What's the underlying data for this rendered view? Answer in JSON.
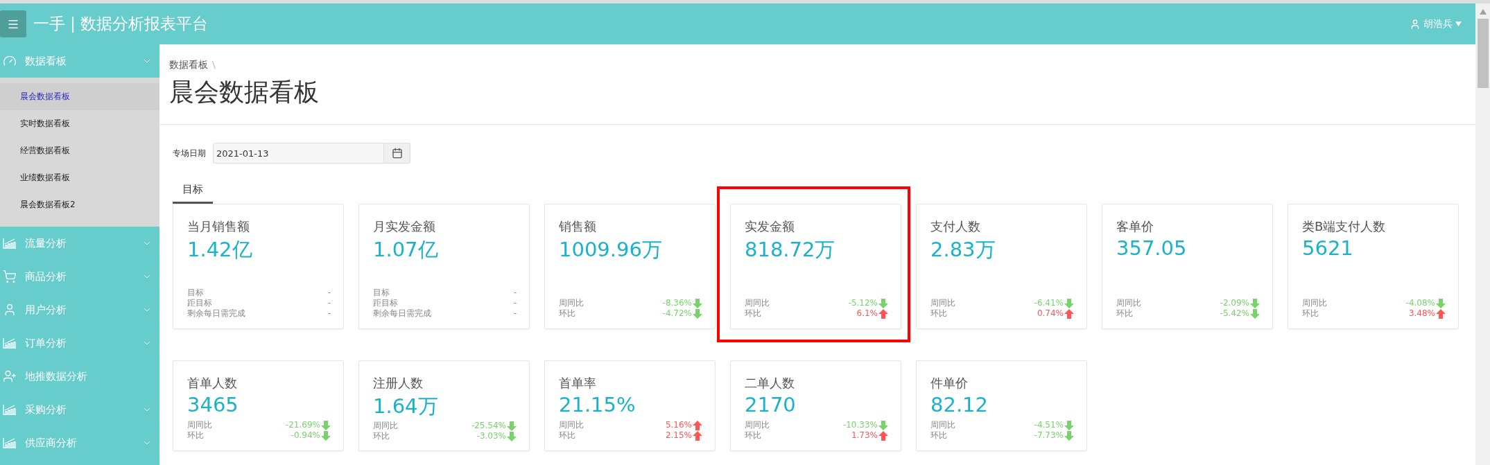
{
  "header": {
    "title": "一手 | 数据分析报表平台",
    "user": "胡浩兵"
  },
  "sidebar": {
    "items": [
      {
        "label": "数据看板",
        "kind": "gauge",
        "expandable": true,
        "expanded": true,
        "children": [
          {
            "label": "晨会数据看板",
            "selected": true
          },
          {
            "label": "实时数据看板",
            "selected": false
          },
          {
            "label": "经营数据看板",
            "selected": false
          },
          {
            "label": "业绩数据看板",
            "selected": false
          },
          {
            "label": "晨会数据看板2",
            "selected": false
          }
        ]
      },
      {
        "label": "流量分析",
        "kind": "chart",
        "expandable": true,
        "expanded": false
      },
      {
        "label": "商品分析",
        "kind": "cart",
        "expandable": true,
        "expanded": false
      },
      {
        "label": "用户分析",
        "kind": "user",
        "expandable": true,
        "expanded": false
      },
      {
        "label": "订单分析",
        "kind": "chart",
        "expandable": true,
        "expanded": false
      },
      {
        "label": "地推数据分析",
        "kind": "user-add",
        "expandable": false
      },
      {
        "label": "采购分析",
        "kind": "chart",
        "expandable": true,
        "expanded": false
      },
      {
        "label": "供应商分析",
        "kind": "chart",
        "expandable": true,
        "expanded": false
      }
    ]
  },
  "breadcrumb": [
    "数据看板"
  ],
  "breadcrumb_separator": "\\",
  "page_title": "晨会数据看板",
  "filter": {
    "label": "专场日期",
    "value": "2021-01-13"
  },
  "tabs": [
    {
      "label": "目标",
      "selected": true
    }
  ],
  "cards": [
    {
      "title": "当月销售额",
      "value": "1.42亿",
      "highlighted": false,
      "metrics": [
        {
          "label": "目标",
          "value": "-",
          "kind": "plain"
        },
        {
          "label": "距目标",
          "value": "-",
          "kind": "plain"
        },
        {
          "label": "剩余每日需完成",
          "value": "-",
          "kind": "plain"
        }
      ]
    },
    {
      "title": "月实发金额",
      "value": "1.07亿",
      "highlighted": false,
      "metrics": [
        {
          "label": "目标",
          "value": "-",
          "kind": "plain"
        },
        {
          "label": "距目标",
          "value": "-",
          "kind": "plain"
        },
        {
          "label": "剩余每日需完成",
          "value": "-",
          "kind": "plain"
        }
      ]
    },
    {
      "title": "销售额",
      "value": "1009.96万",
      "highlighted": false,
      "metrics": [
        {
          "label": "周同比",
          "value": "-8.36%",
          "kind": "change",
          "rising": false
        },
        {
          "label": "环比",
          "value": "-4.72%",
          "kind": "change",
          "rising": false
        }
      ]
    },
    {
      "title": "实发金额",
      "value": "818.72万",
      "highlighted": true,
      "metrics": [
        {
          "label": "周同比",
          "value": "-5.12%",
          "kind": "change",
          "rising": false
        },
        {
          "label": "环比",
          "value": "6.1%",
          "kind": "change",
          "rising": true
        }
      ]
    },
    {
      "title": "支付人数",
      "value": "2.83万",
      "highlighted": false,
      "metrics": [
        {
          "label": "周同比",
          "value": "-6.41%",
          "kind": "change",
          "rising": false
        },
        {
          "label": "环比",
          "value": "0.74%",
          "kind": "change",
          "rising": true
        }
      ]
    },
    {
      "title": "客单价",
      "value": "357.05",
      "highlighted": false,
      "metrics": [
        {
          "label": "周同比",
          "value": "-2.09%",
          "kind": "change",
          "rising": false
        },
        {
          "label": "环比",
          "value": "-5.42%",
          "kind": "change",
          "rising": false
        }
      ]
    },
    {
      "title": "类B端支付人数",
      "value": "5621",
      "highlighted": false,
      "metrics": [
        {
          "label": "周同比",
          "value": "-4.08%",
          "kind": "change",
          "rising": false
        },
        {
          "label": "环比",
          "value": "3.48%",
          "kind": "change",
          "rising": true
        }
      ]
    },
    {
      "title": "首单人数",
      "value": "3465",
      "highlighted": false,
      "metrics": [
        {
          "label": "周同比",
          "value": "-21.69%",
          "kind": "change",
          "rising": false
        },
        {
          "label": "环比",
          "value": "-0.94%",
          "kind": "change",
          "rising": false
        }
      ]
    },
    {
      "title": "注册人数",
      "value": "1.64万",
      "highlighted": false,
      "metrics": [
        {
          "label": "周同比",
          "value": "-25.54%",
          "kind": "change",
          "rising": false
        },
        {
          "label": "环比",
          "value": "-3.03%",
          "kind": "change",
          "rising": false
        }
      ]
    },
    {
      "title": "首单率",
      "value": "21.15%",
      "highlighted": false,
      "metrics": [
        {
          "label": "周同比",
          "value": "5.16%",
          "kind": "change",
          "rising": true
        },
        {
          "label": "环比",
          "value": "2.15%",
          "kind": "change",
          "rising": true
        }
      ]
    },
    {
      "title": "二单人数",
      "value": "2170",
      "highlighted": false,
      "metrics": [
        {
          "label": "周同比",
          "value": "-10.33%",
          "kind": "change",
          "rising": false
        },
        {
          "label": "环比",
          "value": "1.73%",
          "kind": "change",
          "rising": true
        }
      ]
    },
    {
      "title": "件单价",
      "value": "82.12",
      "highlighted": false,
      "metrics": [
        {
          "label": "周同比",
          "value": "-4.51%",
          "kind": "change",
          "rising": false
        },
        {
          "label": "环比",
          "value": "-7.73%",
          "kind": "change",
          "rising": false
        }
      ]
    }
  ]
}
